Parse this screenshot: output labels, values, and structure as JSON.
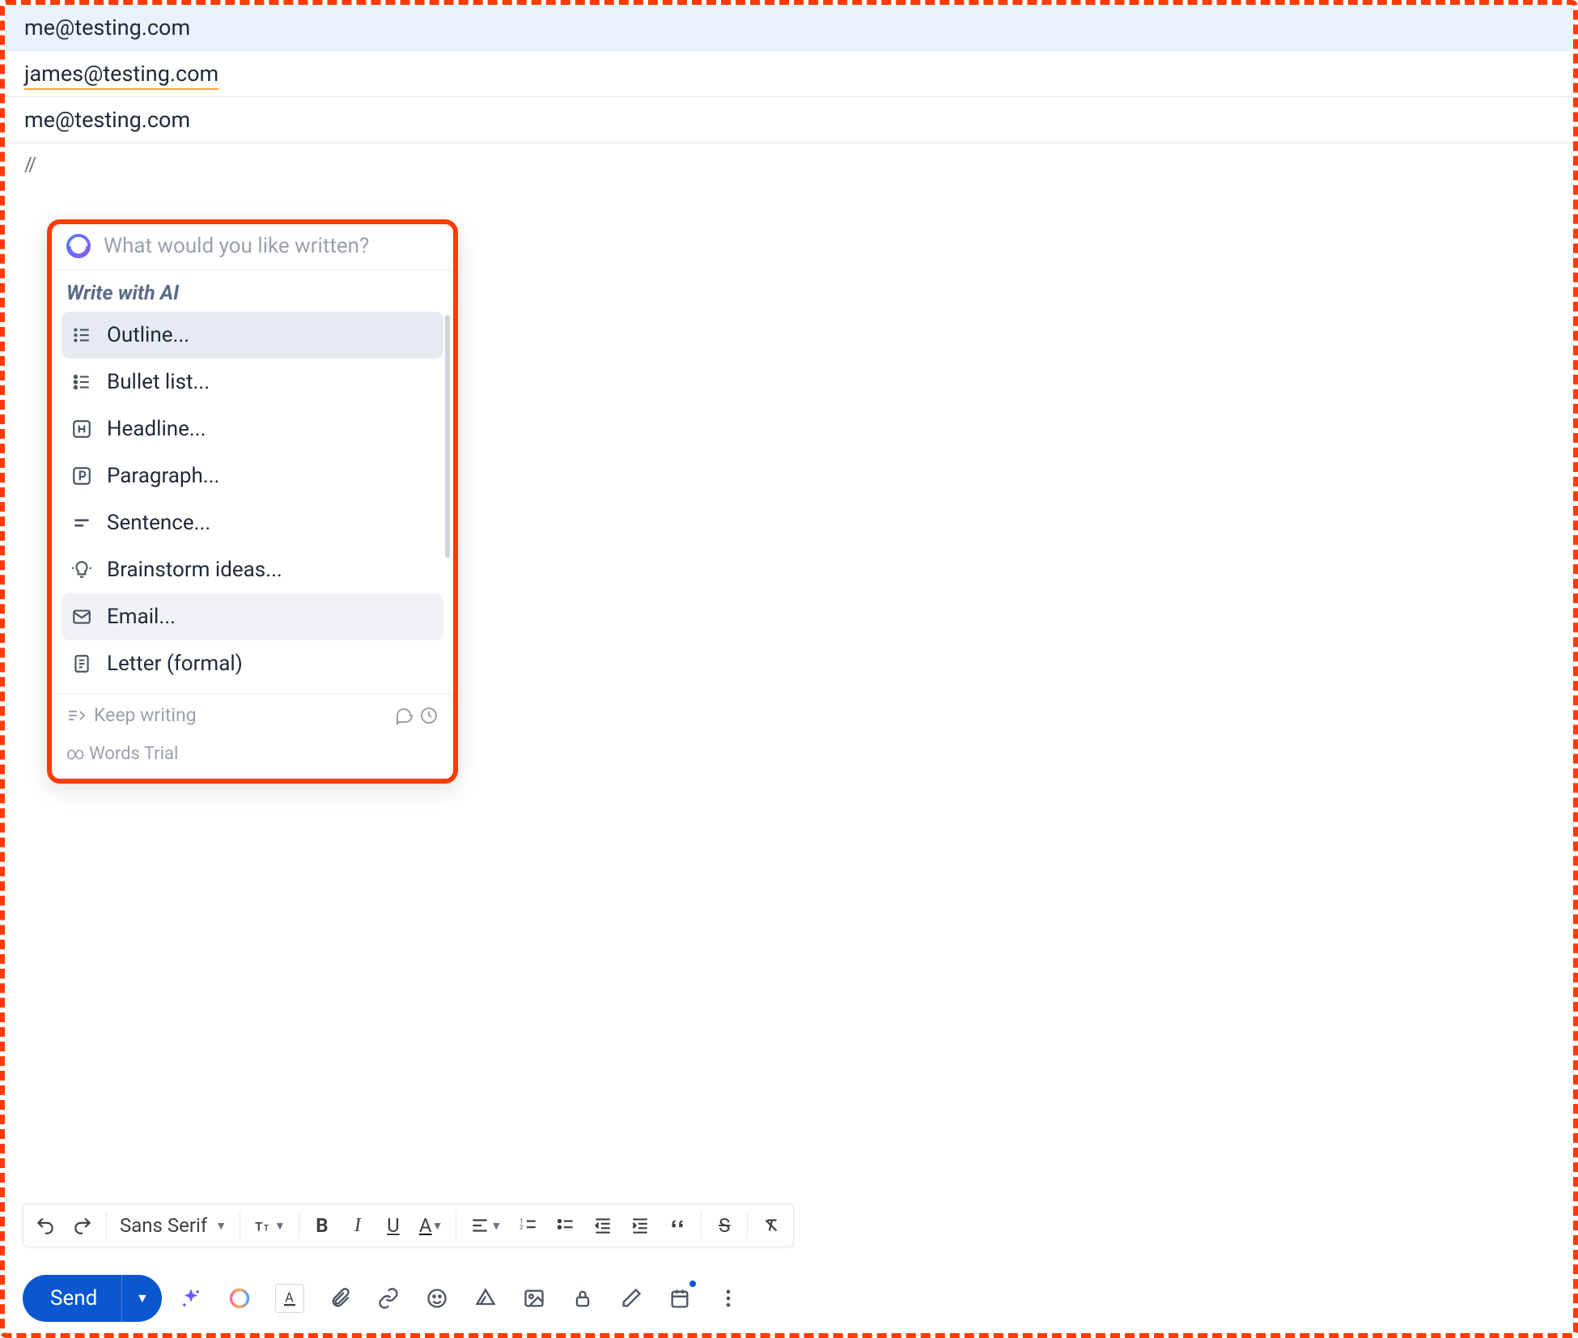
{
  "header": {
    "from": "me@testing.com",
    "to": "james@testing.com",
    "cc": "me@testing.com"
  },
  "body": {
    "prefix": "//"
  },
  "ai_popup": {
    "placeholder": "What would you like written?",
    "section_title": "Write with AI",
    "items": [
      {
        "icon": "list-numbered",
        "label": "Outline..."
      },
      {
        "icon": "list-bullet",
        "label": "Bullet list..."
      },
      {
        "icon": "h-box",
        "label": "Headline..."
      },
      {
        "icon": "p-box",
        "label": "Paragraph..."
      },
      {
        "icon": "lines",
        "label": "Sentence..."
      },
      {
        "icon": "lightbulb",
        "label": "Brainstorm ideas..."
      },
      {
        "icon": "envelope",
        "label": "Email..."
      },
      {
        "icon": "document",
        "label": "Letter (formal)"
      }
    ],
    "footer": {
      "keep_writing": "Keep writing",
      "trial": "∞ Words Trial"
    }
  },
  "format_toolbar": {
    "font": "Sans Serif"
  },
  "send_button": "Send"
}
